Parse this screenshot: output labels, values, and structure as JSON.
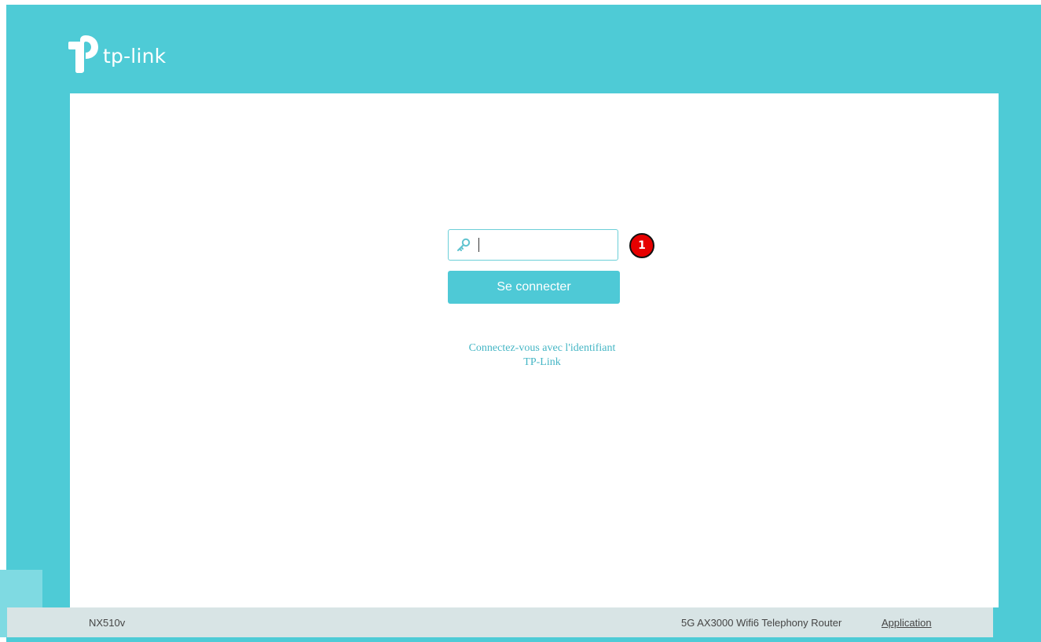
{
  "brand": {
    "name": "tp-link"
  },
  "login": {
    "password_value": "",
    "password_placeholder": "",
    "submit_label": "Se connecter",
    "tplink_id_link_line1": "Connectez-vous avec l'identifiant",
    "tplink_id_link_line2": "TP-Link"
  },
  "annotation": {
    "step_badge": "1"
  },
  "footer": {
    "model": "NX510v",
    "product": "5G AX3000 Wifi6 Telephony Router",
    "app_link": "Application"
  },
  "colors": {
    "accent": "#4ecbd6",
    "badge": "#e60000",
    "footer_bg": "#d8e4e5"
  },
  "icons": {
    "logo": "tp-link-logo-icon",
    "password": "key-icon"
  }
}
